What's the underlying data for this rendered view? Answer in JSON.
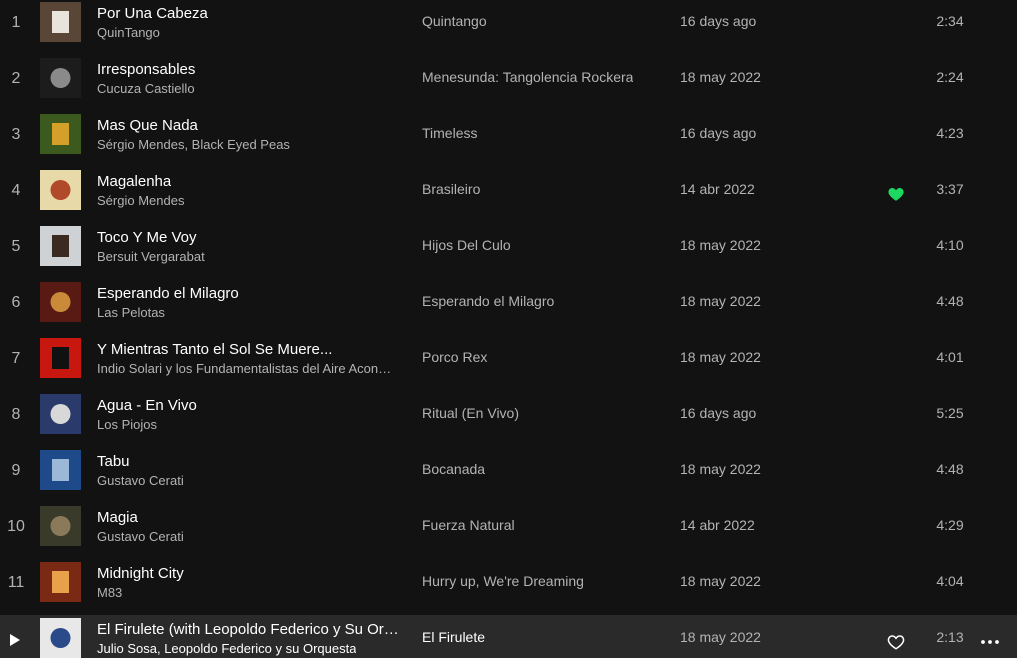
{
  "tracks": [
    {
      "num": "1",
      "title": "Por Una Cabeza",
      "artist": "QuinTango",
      "album": "Quintango",
      "added": "16 days ago",
      "duration": "2:34",
      "liked": false,
      "cover_icon": "album-cover-icon",
      "cover_colors": [
        "#5a4636",
        "#e8e4dc"
      ]
    },
    {
      "num": "2",
      "title": "Irresponsables",
      "artist": "Cucuza Castiello",
      "album": "Menesunda: Tangolencia Rockera",
      "added": "18 may 2022",
      "duration": "2:24",
      "liked": false,
      "cover_icon": "album-cover-icon",
      "cover_colors": [
        "#1c1c1c",
        "#8a8a8a"
      ]
    },
    {
      "num": "3",
      "title": "Mas Que Nada",
      "artist": "Sérgio Mendes, Black Eyed Peas",
      "album": "Timeless",
      "added": "16 days ago",
      "duration": "4:23",
      "liked": false,
      "cover_icon": "album-cover-icon",
      "cover_colors": [
        "#3d5a1e",
        "#d4a02a"
      ]
    },
    {
      "num": "4",
      "title": "Magalenha",
      "artist": "Sérgio Mendes",
      "album": "Brasileiro",
      "added": "14 abr 2022",
      "duration": "3:37",
      "liked": true,
      "cover_icon": "album-cover-icon",
      "cover_colors": [
        "#e8d9a8",
        "#b04a2a"
      ]
    },
    {
      "num": "5",
      "title": "Toco Y Me Voy",
      "artist": "Bersuit Vergarabat",
      "album": "Hijos Del Culo",
      "added": "18 may 2022",
      "duration": "4:10",
      "liked": false,
      "cover_icon": "album-cover-icon",
      "cover_colors": [
        "#cfd2d4",
        "#3b2a20"
      ]
    },
    {
      "num": "6",
      "title": "Esperando el Milagro",
      "artist": "Las Pelotas",
      "album": "Esperando el Milagro",
      "added": "18 may 2022",
      "duration": "4:48",
      "liked": false,
      "cover_icon": "album-cover-icon",
      "cover_colors": [
        "#5a1a14",
        "#c98a3a"
      ]
    },
    {
      "num": "7",
      "title": "Y Mientras Tanto el Sol Se Muere...",
      "artist": "Indio Solari y los Fundamentalistas del Aire Acondicionado",
      "album": "Porco Rex",
      "added": "18 may 2022",
      "duration": "4:01",
      "liked": false,
      "cover_icon": "album-cover-icon",
      "cover_colors": [
        "#c8170e",
        "#111111"
      ]
    },
    {
      "num": "8",
      "title": "Agua - En Vivo",
      "artist": "Los Piojos",
      "album": "Ritual (En Vivo)",
      "added": "16 days ago",
      "duration": "5:25",
      "liked": false,
      "cover_icon": "album-cover-icon",
      "cover_colors": [
        "#2a3a6a",
        "#d8d8d8"
      ]
    },
    {
      "num": "9",
      "title": "Tabu",
      "artist": "Gustavo Cerati",
      "album": "Bocanada",
      "added": "18 may 2022",
      "duration": "4:48",
      "liked": false,
      "cover_icon": "album-cover-icon",
      "cover_colors": [
        "#1f4a8a",
        "#9bb8d8"
      ]
    },
    {
      "num": "10",
      "title": "Magia",
      "artist": "Gustavo Cerati",
      "album": "Fuerza Natural",
      "added": "14 abr 2022",
      "duration": "4:29",
      "liked": false,
      "cover_icon": "album-cover-icon",
      "cover_colors": [
        "#3a3a2a",
        "#8a7a5a"
      ]
    },
    {
      "num": "11",
      "title": "Midnight City",
      "artist": "M83",
      "album": "Hurry up, We're Dreaming",
      "added": "18 may 2022",
      "duration": "4:04",
      "liked": false,
      "cover_icon": "album-cover-icon",
      "cover_colors": [
        "#7a2a14",
        "#e8a04a"
      ]
    },
    {
      "num": "",
      "title": "El Firulete (with Leopoldo Federico y Su Orquesta)",
      "artist": "Julio Sosa, Leopoldo Federico y su Orquesta",
      "album": "El Firulete",
      "added": "18 may 2022",
      "duration": "2:13",
      "liked": false,
      "hovered": true,
      "cover_icon": "album-cover-icon",
      "cover_colors": [
        "#e8e8e8",
        "#2a4a8a"
      ]
    }
  ],
  "icons": {
    "play": "play-icon",
    "heart_filled": "heart-filled-icon",
    "heart_outline": "heart-outline-icon",
    "more": "more-options-icon"
  },
  "colors": {
    "background": "#121212",
    "row_hover": "#2a2a2a",
    "text_primary": "#ffffff",
    "text_secondary": "#b3b3b3",
    "accent_green": "#1ed760"
  }
}
